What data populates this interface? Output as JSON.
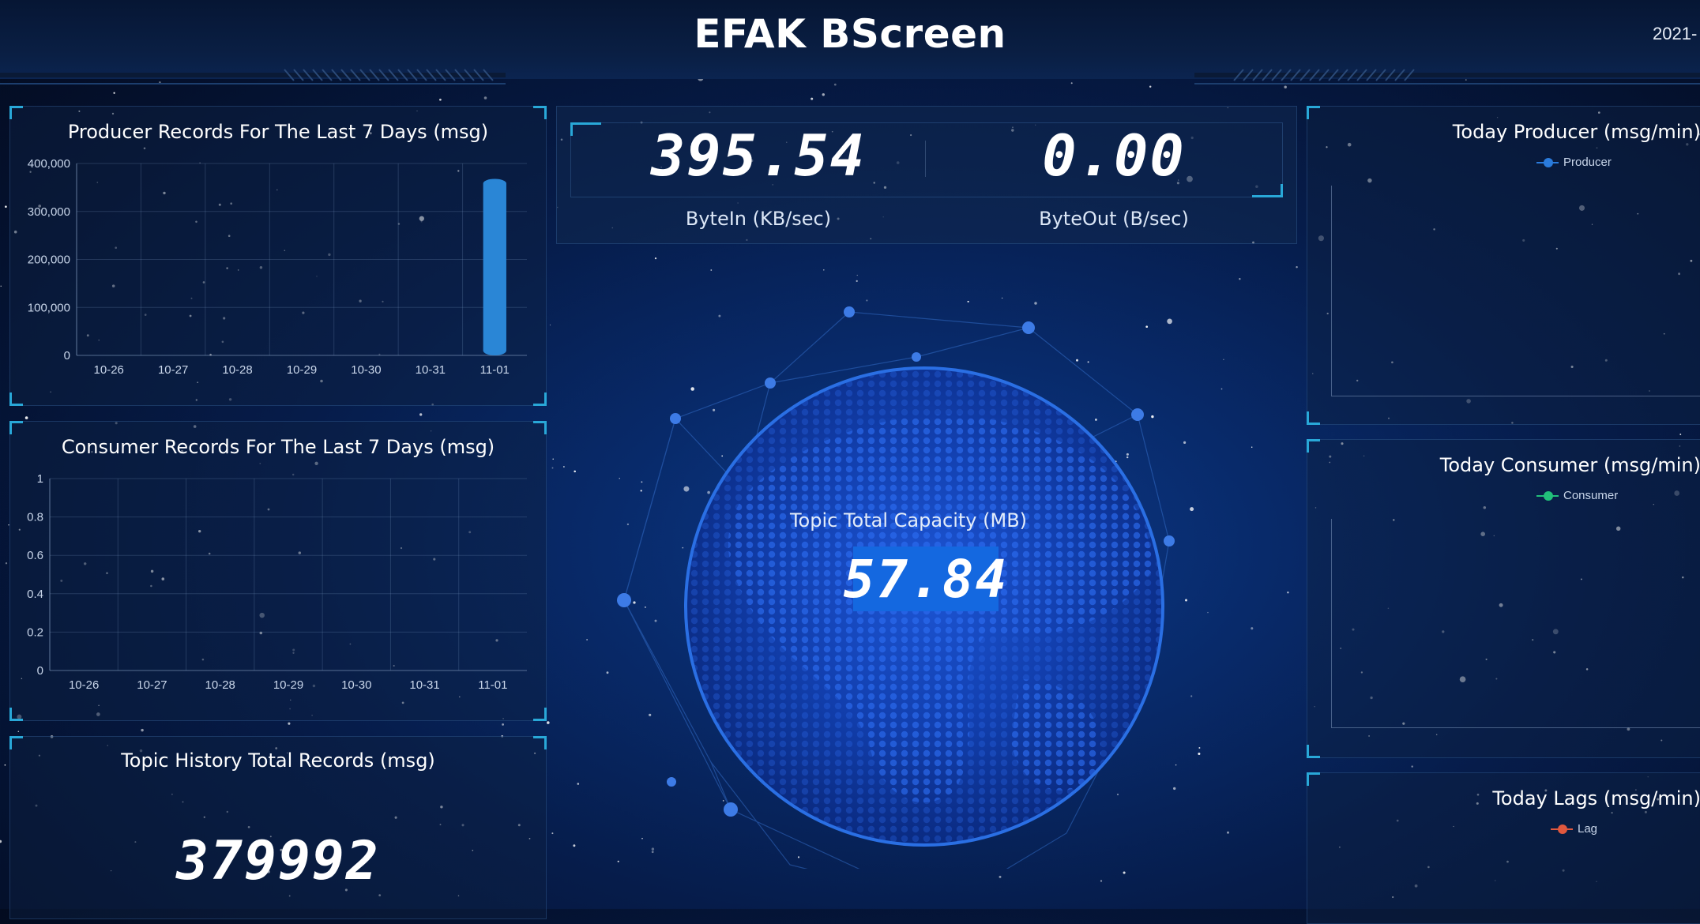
{
  "header": {
    "title": "EFAK BScreen",
    "date": "2021-"
  },
  "kpi": {
    "byte_in": {
      "value": "395.54",
      "label": "ByteIn (KB/sec)"
    },
    "byte_out": {
      "value": "0.00",
      "label": "ByteOut (B/sec)"
    }
  },
  "capacity": {
    "label": "Topic Total Capacity (MB)",
    "value": "57.84"
  },
  "history": {
    "title": "Topic History Total Records (msg)",
    "value": "379992"
  },
  "panels": {
    "today_producer": {
      "title": "Today Producer (msg/min)",
      "legend": "Producer",
      "color": "#2a7bdc"
    },
    "today_consumer": {
      "title": "Today Consumer (msg/min)",
      "legend": "Consumer",
      "color": "#21c07a"
    },
    "today_lags": {
      "title": "Today Lags (msg/min)",
      "legend": "Lag",
      "color": "#e0583e"
    }
  },
  "chart_data": [
    {
      "type": "bar",
      "title": "Producer Records For The Last 7 Days (msg)",
      "categories": [
        "10-26",
        "10-27",
        "10-28",
        "10-29",
        "10-30",
        "10-31",
        "11-01"
      ],
      "values": [
        0,
        0,
        0,
        0,
        0,
        0,
        368000
      ],
      "ylim": [
        0,
        400000
      ],
      "yticks": [
        "0",
        "100,000",
        "200,000",
        "300,000",
        "400,000"
      ],
      "color": "#2a86d6",
      "grid": true
    },
    {
      "type": "line",
      "title": "Consumer Records For The Last 7 Days (msg)",
      "categories": [
        "10-26",
        "10-27",
        "10-28",
        "10-29",
        "10-30",
        "10-31",
        "11-01"
      ],
      "values": [],
      "ylim": [
        0,
        1
      ],
      "yticks": [
        "0",
        "0.2",
        "0.4",
        "0.6",
        "0.8",
        "1"
      ],
      "grid": true
    }
  ]
}
